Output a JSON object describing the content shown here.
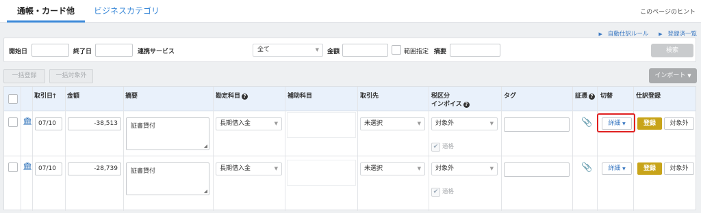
{
  "tabs": [
    {
      "label": "通帳・カード他"
    },
    {
      "label": "ビジネスカテゴリ"
    }
  ],
  "page_hint": "このページのヒント",
  "links": [
    {
      "label": "自動仕訳ルール"
    },
    {
      "label": "登録済一覧"
    }
  ],
  "filters": {
    "start_date_label": "開始日",
    "end_date_label": "終了日",
    "service_label": "連携サービス",
    "service_value": "全て",
    "amount_label": "金額",
    "range_label": "範囲指定",
    "memo_label": "摘要",
    "search_label": "検索"
  },
  "actions": {
    "bulk_register": "一括登録",
    "bulk_exclude": "一括対象外",
    "import": "インポート"
  },
  "table": {
    "columns": {
      "date": "取引日",
      "amount": "金額",
      "memo": "摘要",
      "account": "勘定科目",
      "subaccount": "補助科目",
      "partner": "取引先",
      "tax_line1": "税区分",
      "tax_line2": "インボイス",
      "tag": "タグ",
      "evidence": "証憑",
      "switch": "切替",
      "journal": "仕訳登録"
    },
    "rows": [
      {
        "date": "07/10",
        "amount": "-38,513",
        "memo": "証書貸付",
        "account": "長期借入金",
        "partner": "未選択",
        "tax": "対象外",
        "qualified": "適格",
        "detail": "詳細",
        "register": "登録",
        "exclude": "対象外"
      },
      {
        "date": "07/10",
        "amount": "-28,739",
        "memo": "証書貸付",
        "account": "長期借入金",
        "partner": "未選択",
        "tax": "対象外",
        "qualified": "適格",
        "detail": "詳細",
        "register": "登録",
        "exclude": "対象外"
      }
    ]
  },
  "colors": {
    "accent": "#3a88d8",
    "register": "#c8a41a",
    "highlight": "#e02020"
  }
}
